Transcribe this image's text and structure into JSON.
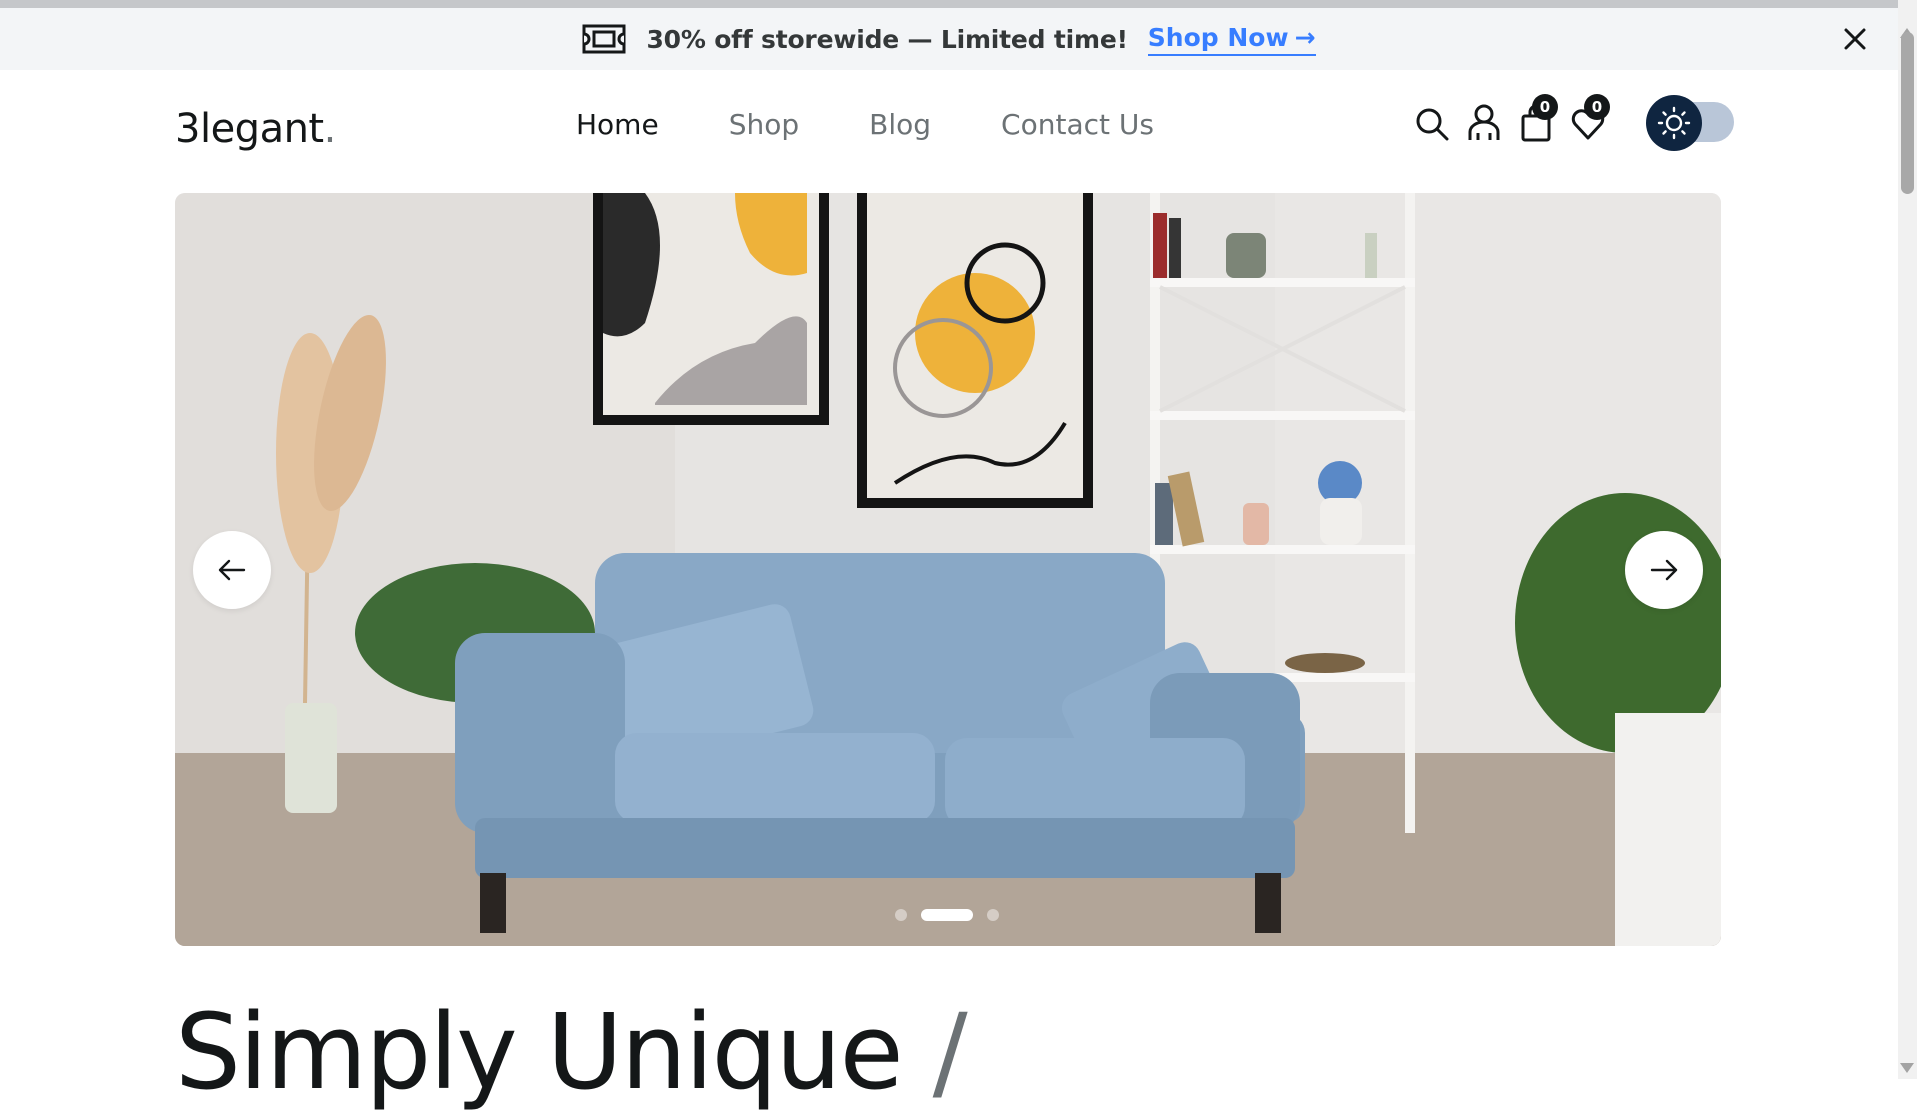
{
  "promo": {
    "icon": "ticket-icon",
    "text": "30% off storewide — Limited time!",
    "link_label": "Shop Now",
    "link_arrow": "→"
  },
  "header": {
    "logo_text": "3legant",
    "logo_dot": ".",
    "menu": [
      {
        "label": "Home",
        "active": true
      },
      {
        "label": "Shop",
        "active": false
      },
      {
        "label": "Blog",
        "active": false
      },
      {
        "label": "Contact Us",
        "active": false
      }
    ],
    "cart_count": "0",
    "wishlist_count": "0",
    "theme": "light"
  },
  "hero": {
    "image": "blue-sofa-living-room-photo",
    "slides": 3,
    "active_slide": 2
  },
  "headline": {
    "text": "Simply Unique",
    "slash": "/"
  },
  "colors": {
    "accent": "#377dff",
    "dark": "#141718",
    "muted": "#6c7275",
    "promo_bg": "#f3f5f7",
    "toggle_knob": "#0f2540"
  }
}
